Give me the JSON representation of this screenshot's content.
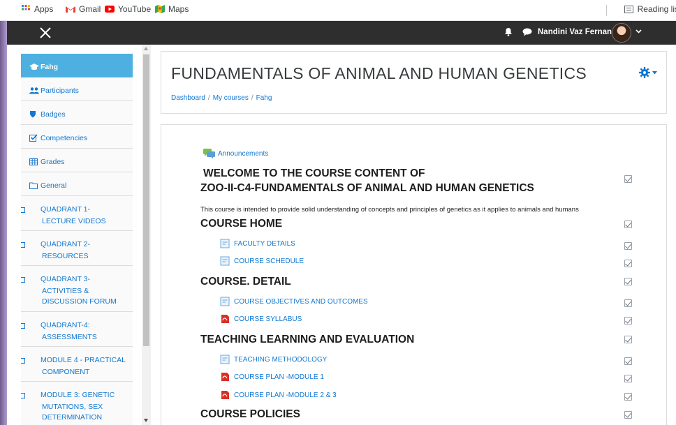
{
  "bookmarks": {
    "apps": "Apps",
    "gmail": "Gmail",
    "youtube": "YouTube",
    "maps": "Maps",
    "reading_list": "Reading lis"
  },
  "navbar": {
    "user_name": "Nandini Vaz Fernandes"
  },
  "sidebar": {
    "items": [
      {
        "label": "Fahg",
        "icon": "graduation-cap-icon"
      },
      {
        "label": "Participants",
        "icon": "users-icon"
      },
      {
        "label": "Badges",
        "icon": "shield-icon"
      },
      {
        "label": "Competencies",
        "icon": "checkbox-icon"
      },
      {
        "label": "Grades",
        "icon": "table-icon"
      },
      {
        "label": "General",
        "icon": "folder-icon"
      },
      {
        "label": "QUADRANT 1- LECTURE VIDEOS",
        "icon": "folder-icon"
      },
      {
        "label": "QUADRANT 2- RESOURCES",
        "icon": "folder-icon"
      },
      {
        "label": "QUADRANT 3- ACTIVITIES & DISCUSSION FORUM",
        "icon": "folder-icon"
      },
      {
        "label": "QUADRANT-4: ASSESSMENTS",
        "icon": "folder-icon"
      },
      {
        "label": "MODULE 4 - PRACTICAL COMPONENT",
        "icon": "folder-icon"
      },
      {
        "label": "MODULE 3: GENETIC MUTATIONS, SEX DETERMINATION",
        "icon": "folder-icon"
      }
    ]
  },
  "header": {
    "title": "FUNDAMENTALS OF ANIMAL AND HUMAN GENETICS",
    "breadcrumb": [
      "Dashboard",
      "My courses",
      "Fahg"
    ]
  },
  "content": {
    "announcements": "Announcements",
    "welcome_line1": "WELCOME TO THE COURSE CONTENT OF",
    "welcome_line2": "ZOO-II-C4-FUNDAMENTALS OF ANIMAL AND HUMAN GENETICS",
    "description": "This course is intended to provide solid understanding of concepts and principles of genetics as it applies to animals and humans",
    "sections": [
      {
        "title": "COURSE HOME",
        "items": [
          {
            "label": "FACULTY DETAILS",
            "type": "page"
          },
          {
            "label": "COURSE SCHEDULE",
            "type": "page"
          }
        ]
      },
      {
        "title": "COURSE. DETAIL",
        "items": [
          {
            "label": "COURSE OBJECTIVES AND OUTCOMES",
            "type": "page"
          },
          {
            "label": "COURSE SYLLABUS",
            "type": "pdf"
          }
        ]
      },
      {
        "title": "TEACHING LEARNING AND EVALUATION",
        "items": [
          {
            "label": "TEACHING METHODOLOGY",
            "type": "page"
          },
          {
            "label": "COURSE PLAN -MODULE 1",
            "type": "pdf"
          },
          {
            "label": "COURSE PLAN -MODULE 2 & 3",
            "type": "pdf"
          }
        ]
      },
      {
        "title": "COURSE POLICIES",
        "items": []
      }
    ]
  },
  "colors": {
    "link": "#1177d1",
    "active_sidebar": "#4db0e0",
    "navbar": "#2e2e2e"
  }
}
